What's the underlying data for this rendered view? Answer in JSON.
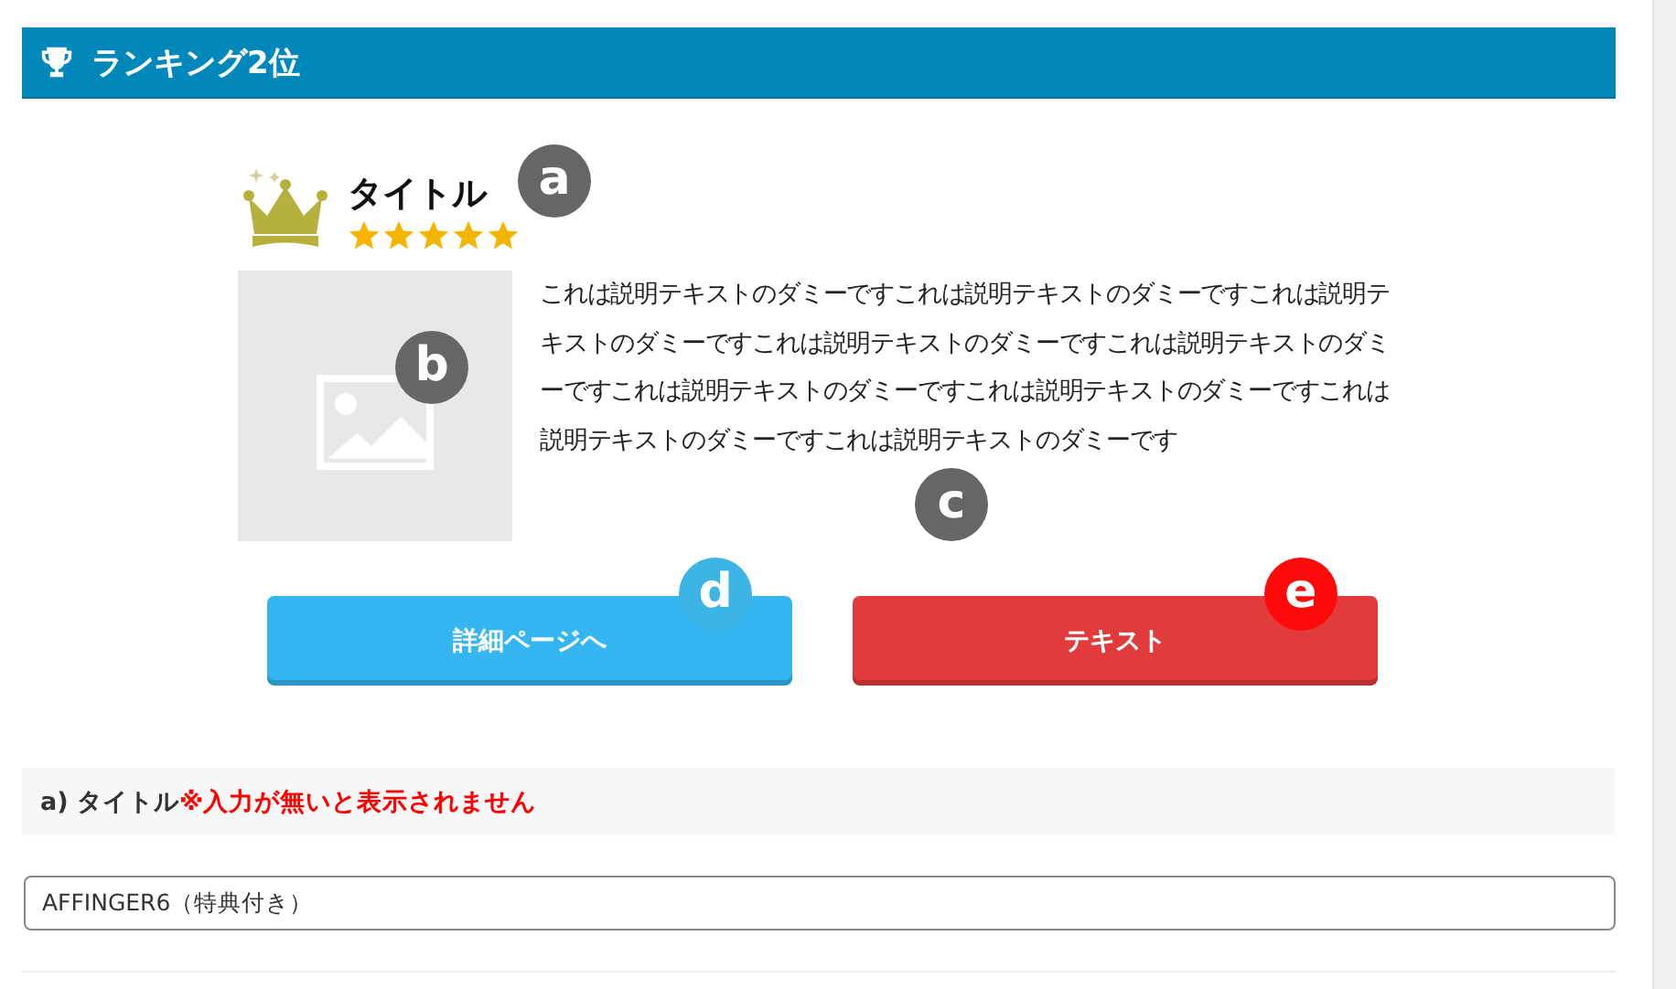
{
  "header": {
    "title": "ランキング2位"
  },
  "item": {
    "title": "タイトル",
    "stars": 5,
    "description": "これは説明テキストのダミーですこれは説明テキストのダミーですこれは説明テキストのダミーですこれは説明テキストのダミーですこれは説明テキストのダミーですこれは説明テキストのダミーですこれは説明テキストのダミーですこれは説明テキストのダミーですこれは説明テキストのダミーです"
  },
  "buttons": [
    {
      "label": "詳細ページへ",
      "color": "#35b6f0"
    },
    {
      "label": "テキスト",
      "color": "#e23b3b"
    }
  ],
  "markers": [
    {
      "label": "a",
      "color": "#666666"
    },
    {
      "label": "b",
      "color": "#666666"
    },
    {
      "label": "c",
      "color": "#666666"
    },
    {
      "label": "d",
      "color": "#3cb4e6"
    },
    {
      "label": "e",
      "color": "#ff0a0a"
    }
  ],
  "field": {
    "label": "a) タイトル",
    "note": "※入力が無いと表示されません",
    "value": "AFFINGER6（特典付き）"
  }
}
